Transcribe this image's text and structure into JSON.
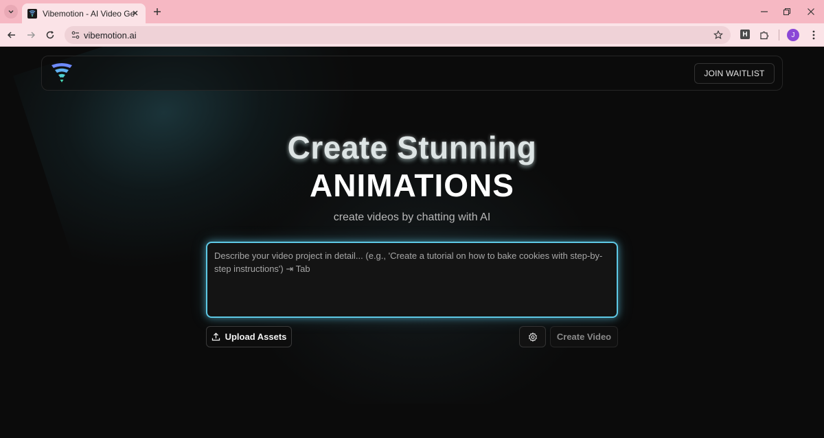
{
  "browser": {
    "tab_title": "Vibemotion - AI Video Generato",
    "url": "vibemotion.ai",
    "extension_label": "H",
    "profile_initial": "J",
    "colors": {
      "tabbar": "#f6b8c3",
      "toolbar": "#fbe3e7",
      "avatar": "#8b47d6"
    }
  },
  "navbar": {
    "logo_icon": "vibemotion-wifi-logo-icon",
    "join_label": "JOIN WAITLIST"
  },
  "hero": {
    "title_line1": "Create Stunning",
    "title_line2": "ANIMATIONS",
    "subtitle": "create videos by chatting with AI"
  },
  "prompt": {
    "placeholder": "Describe your video project in detail... (e.g., 'Create a tutorial on how to bake cookies with step-by-step instructions') ⇥ Tab",
    "value": ""
  },
  "actions": {
    "upload_label": "Upload Assets",
    "settings_icon": "gear-icon",
    "create_label": "Create Video"
  },
  "colors": {
    "accent": "#5ec9e6",
    "background": "#0b0b0b"
  }
}
